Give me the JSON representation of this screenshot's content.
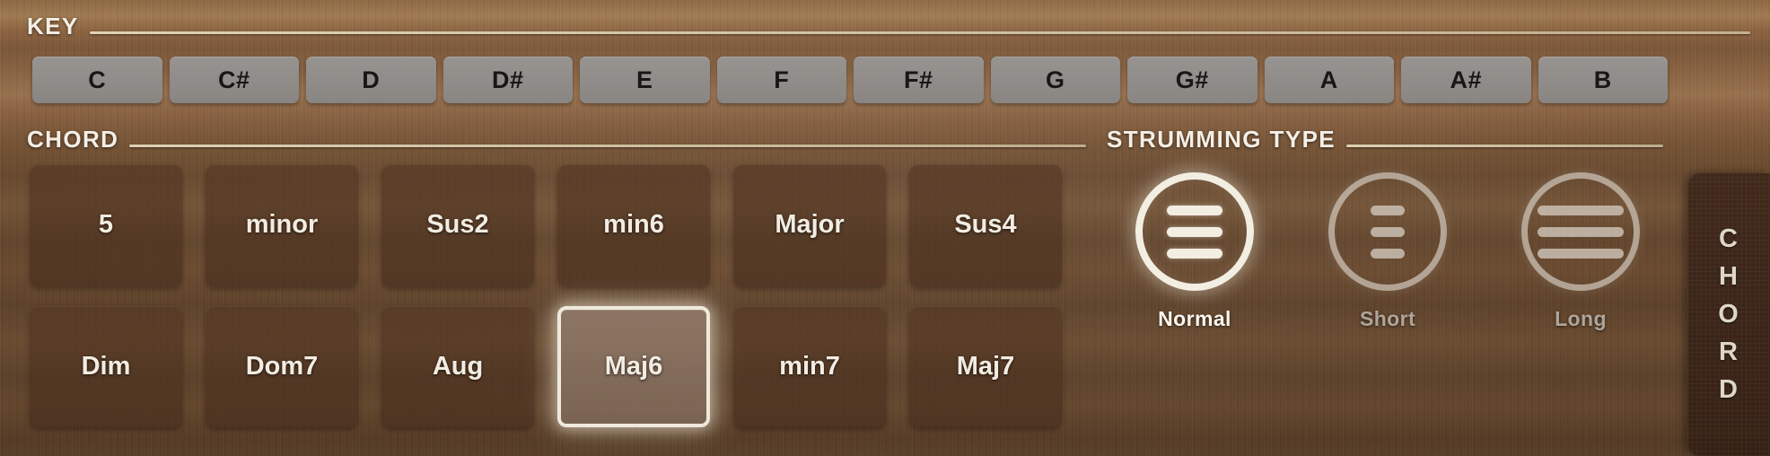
{
  "key_section": {
    "title": "KEY",
    "keys": [
      "C",
      "C#",
      "D",
      "D#",
      "E",
      "F",
      "F#",
      "G",
      "G#",
      "A",
      "A#",
      "B"
    ]
  },
  "chord_section": {
    "title": "CHORD",
    "buttons": [
      "5",
      "minor",
      "Sus2",
      "min6",
      "Major",
      "Sus4",
      "Dim",
      "Dom7",
      "Aug",
      "Maj6",
      "min7",
      "Maj7"
    ],
    "selected": "Maj6"
  },
  "strumming_section": {
    "title": "STRUMMING TYPE",
    "options": [
      {
        "label": "Normal",
        "icon": "strum-normal-icon",
        "state": "active",
        "bars": 3
      },
      {
        "label": "Short",
        "icon": "strum-short-icon",
        "state": "inactive",
        "bars": 3
      },
      {
        "label": "Long",
        "icon": "strum-long-icon",
        "state": "inactive",
        "bars": 3
      }
    ],
    "selected": "Normal"
  },
  "side_tab": {
    "letters": [
      "C",
      "H",
      "O",
      "R",
      "D"
    ],
    "label": "CHORD"
  },
  "colors": {
    "wood_base": "#8a6240",
    "key_button": "#989694",
    "key_text": "#191716",
    "chord_button": "#543723",
    "chord_text": "#f2ece2",
    "accent_highlight": "#efe9dc",
    "rule": "#e2d8ba",
    "tab_background": "#40291b"
  }
}
